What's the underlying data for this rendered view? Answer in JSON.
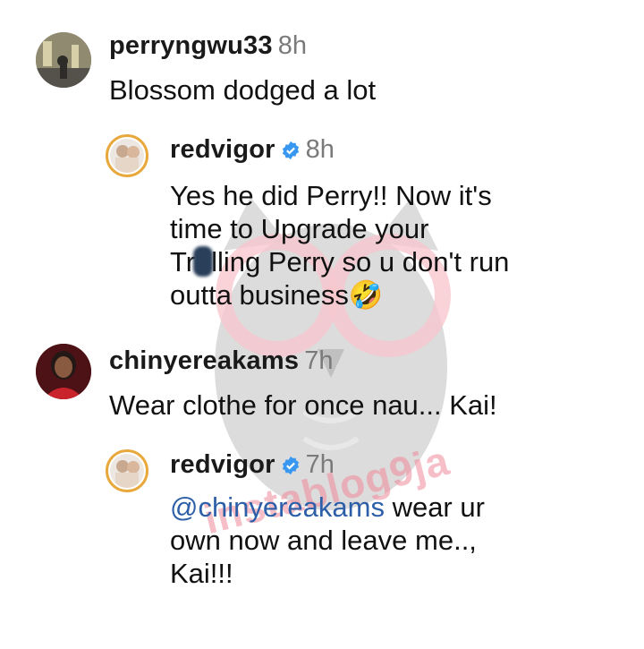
{
  "comments": [
    {
      "username": "perryngwu33",
      "time": "8h",
      "text": "Blossom dodged a lot",
      "avatar": "perryngwu33-avatar",
      "verified": false
    },
    {
      "username": "redvigor",
      "time": "8h",
      "verified": true,
      "text_line1": "Yes he did Perry!! Now it's",
      "text_line2": "time to Upgrade your",
      "text_line3_a": "Tr",
      "text_line3_b": "lling Perry so u don't run",
      "text_line4": "outta business",
      "emoji": "🤣",
      "avatar": "redvigor-avatar"
    },
    {
      "username": "chinyereakams",
      "time": "7h",
      "text": "Wear clothe for once nau... Kai!",
      "avatar": "chinyereakams-avatar",
      "verified": false
    },
    {
      "username": "redvigor",
      "time": "7h",
      "verified": true,
      "mention": "@chinyereakams",
      "text_line1_rest": " wear ur",
      "text_line2": "own now and leave me..,",
      "text_line3": "Kai!!!",
      "avatar": "redvigor-avatar"
    }
  ],
  "watermark": {
    "text": "instablog9ja"
  },
  "colors": {
    "username": "#1a1a1a",
    "time": "#7a7a7a",
    "mention": "#2d5fa8",
    "verified": "#3897f0",
    "story_ring": "#e8a83c"
  }
}
